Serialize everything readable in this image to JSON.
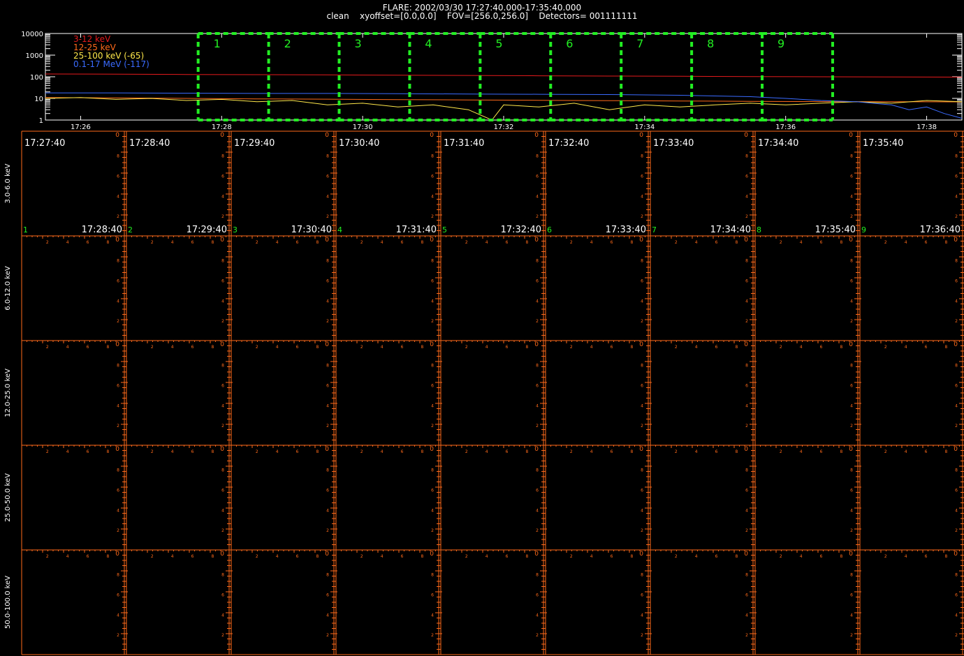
{
  "header": {
    "line1": "FLARE: 2002/03/30 17:27:40.000-17:35:40.000",
    "line2": "clean    xyoffset=[0.0,0.0]    FOV=[256.0,256.0]    Detectors= 001111111"
  },
  "chart_data": [
    {
      "type": "line",
      "scale": "log",
      "ylim": [
        1,
        10000
      ],
      "y_tick_labels": [
        "10000",
        "1000",
        "100",
        "10",
        "1"
      ],
      "y_ticks": [
        10000,
        1000,
        100,
        10,
        1
      ],
      "xlim": [
        "17:25:30",
        "17:38:30"
      ],
      "x_tick_labels": [
        "17:26",
        "17:28",
        "17:30",
        "17:32",
        "17:34",
        "17:36",
        "17:38"
      ],
      "series": [
        {
          "name": "3-12 keV",
          "color": "#e41a1c",
          "x": [
            "17:25:30",
            "17:26:30",
            "17:27:30",
            "17:28:30",
            "17:29:30",
            "17:30:30",
            "17:31:30",
            "17:32:30",
            "17:33:30",
            "17:34:30",
            "17:35:30",
            "17:36:30",
            "17:37:30",
            "17:38:30"
          ],
          "values": [
            135,
            132,
            128,
            125,
            122,
            118,
            115,
            111,
            108,
            105,
            102,
            100,
            98,
            96
          ]
        },
        {
          "name": "12-25 keV",
          "color": "#ff6a1a",
          "x": [
            "17:25:30",
            "17:26:30",
            "17:27:30",
            "17:28:30",
            "17:29:30",
            "17:30:30",
            "17:31:30",
            "17:32:30",
            "17:33:30",
            "17:34:30",
            "17:35:30",
            "17:36:30",
            "17:37:30",
            "17:38:30"
          ],
          "values": [
            11,
            10.5,
            10,
            9.5,
            9.2,
            8.8,
            8.5,
            8.2,
            7.9,
            7.6,
            7.3,
            7.1,
            7,
            6.9
          ]
        },
        {
          "name": "25-100 keV (-65)",
          "color": "#ffe84a",
          "x": [
            "17:25:30",
            "17:26:00",
            "17:26:30",
            "17:27:00",
            "17:27:30",
            "17:28:00",
            "17:28:30",
            "17:29:00",
            "17:29:30",
            "17:30:00",
            "17:30:30",
            "17:31:00",
            "17:31:30",
            "17:31:50",
            "17:32:00",
            "17:32:30",
            "17:33:00",
            "17:33:30",
            "17:34:00",
            "17:34:30",
            "17:35:00",
            "17:35:30",
            "17:36:00",
            "17:36:30",
            "17:37:00",
            "17:37:30",
            "17:38:00",
            "17:38:30"
          ],
          "values": [
            10,
            11,
            9,
            10,
            8,
            9,
            7,
            8,
            5,
            6,
            4,
            5,
            3,
            1,
            5,
            4,
            6,
            3,
            5,
            4,
            5,
            6,
            5,
            6,
            7,
            6,
            8,
            7
          ]
        },
        {
          "name": "0.1-17 MeV (-117)",
          "color": "#3a6bff",
          "x": [
            "17:25:30",
            "17:26:30",
            "17:27:30",
            "17:28:30",
            "17:29:30",
            "17:30:30",
            "17:31:30",
            "17:32:30",
            "17:33:30",
            "17:34:30",
            "17:35:30",
            "17:36:00",
            "17:36:30",
            "17:37:00",
            "17:37:30",
            "17:37:45",
            "17:38:00",
            "17:38:15",
            "17:38:30"
          ],
          "values": [
            18,
            18,
            17.5,
            17,
            17,
            16.5,
            16,
            15.5,
            15,
            14,
            12,
            10,
            8,
            7,
            5,
            3,
            4,
            2,
            1.2
          ]
        }
      ],
      "intervals": [
        {
          "label": "1",
          "start": "17:27:40",
          "end": "17:28:40"
        },
        {
          "label": "2",
          "start": "17:28:40",
          "end": "17:29:40"
        },
        {
          "label": "3",
          "start": "17:29:40",
          "end": "17:30:40"
        },
        {
          "label": "4",
          "start": "17:30:40",
          "end": "17:31:40"
        },
        {
          "label": "5",
          "start": "17:31:40",
          "end": "17:32:40"
        },
        {
          "label": "6",
          "start": "17:32:40",
          "end": "17:33:40"
        },
        {
          "label": "7",
          "start": "17:33:40",
          "end": "17:34:40"
        },
        {
          "label": "8",
          "start": "17:34:40",
          "end": "17:35:40"
        },
        {
          "label": "9",
          "start": "17:35:40",
          "end": "17:36:40"
        }
      ],
      "interval_color": "#22ee22"
    },
    {
      "type": "heatmap",
      "grid_color": "#ff6a1a",
      "label_color": "#22ee22",
      "rows": [
        "3.0-6.0 keV",
        "6.0-12.0 keV",
        "12.0-25.0 keV",
        "25.0-50.0 keV",
        "50.0-100.0 keV"
      ],
      "columns": [
        {
          "index": "1",
          "start": "17:27:40",
          "end": "17:28:40"
        },
        {
          "index": "2",
          "start": "17:28:40",
          "end": "17:29:40"
        },
        {
          "index": "3",
          "start": "17:29:40",
          "end": "17:30:40"
        },
        {
          "index": "4",
          "start": "17:30:40",
          "end": "17:31:40"
        },
        {
          "index": "5",
          "start": "17:31:40",
          "end": "17:32:40"
        },
        {
          "index": "6",
          "start": "17:32:40",
          "end": "17:33:40"
        },
        {
          "index": "7",
          "start": "17:33:40",
          "end": "17:34:40"
        },
        {
          "index": "8",
          "start": "17:34:40",
          "end": "17:35:40"
        },
        {
          "index": "9",
          "start": "17:35:40",
          "end": "17:36:40"
        }
      ],
      "axis_tick_labels": [
        "2",
        "4",
        "6",
        "8"
      ],
      "axis_zero_label": "0"
    }
  ]
}
